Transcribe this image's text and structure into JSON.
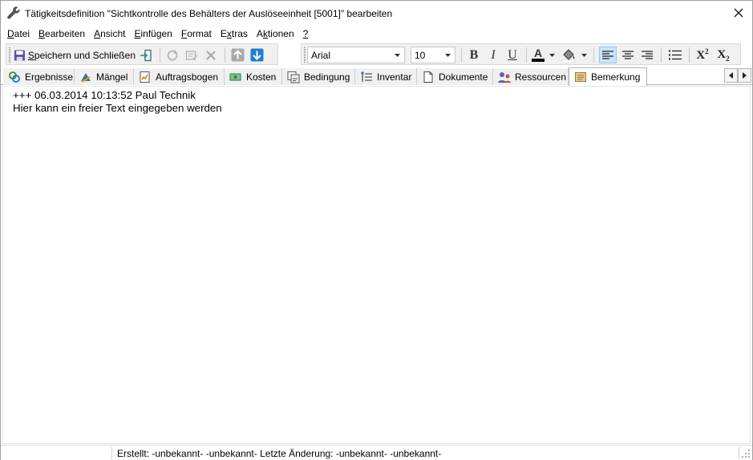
{
  "window": {
    "title": "Tätigkeitsdefinition \"Sichtkontrolle des Behälters der Auslöseeinheit [5001]\" bearbeiten",
    "close_symbol": "✕"
  },
  "menu": [
    {
      "pre": "",
      "u": "D",
      "post": "atei"
    },
    {
      "pre": "",
      "u": "B",
      "post": "earbeiten"
    },
    {
      "pre": "",
      "u": "A",
      "post": "nsicht"
    },
    {
      "pre": "",
      "u": "E",
      "post": "infügen"
    },
    {
      "pre": "",
      "u": "F",
      "post": "ormat"
    },
    {
      "pre": "E",
      "u": "x",
      "post": "tras"
    },
    {
      "pre": "A",
      "u": "k",
      "post": "tionen"
    },
    {
      "pre": "",
      "u": "?",
      "post": ""
    }
  ],
  "toolbar": {
    "save_close_u": "S",
    "save_close_rest": "peichern und Schließen",
    "font_name": "Arial",
    "font_size": "10",
    "bold": "B",
    "italic": "I",
    "underline": "U",
    "font_color_letter": "A",
    "superscript_base": "X",
    "superscript_exp": "2",
    "subscript_base": "X",
    "subscript_idx": "2"
  },
  "tabs": [
    {
      "label": "Ergebnisse",
      "icon": "results-icon"
    },
    {
      "label": "Mängel",
      "icon": "defects-icon"
    },
    {
      "label": "Auftragsbogen",
      "icon": "order-sheet-icon"
    },
    {
      "label": "Kosten",
      "icon": "costs-icon"
    },
    {
      "label": "Bedingung",
      "icon": "condition-icon"
    },
    {
      "label": "Inventar",
      "icon": "inventory-icon"
    },
    {
      "label": "Dokumente",
      "icon": "documents-icon"
    },
    {
      "label": "Ressourcen",
      "icon": "resources-icon"
    },
    {
      "label": "Bemerkung",
      "icon": "remark-icon",
      "active": true
    }
  ],
  "editor": {
    "line1": "+++ 06.03.2014 10:13:52 Paul Technik",
    "line2": "Hier kann ein freier Text eingegeben werden"
  },
  "status": {
    "text": "Erstellt: -unbekannt- -unbekannt-  Letzte Änderung: -unbekannt- -unbekannt-"
  },
  "colors": {
    "accent_blue": "#1e7fd0",
    "active_button": "#cce4f7",
    "toolbar_bg": "#f0f0f0"
  }
}
